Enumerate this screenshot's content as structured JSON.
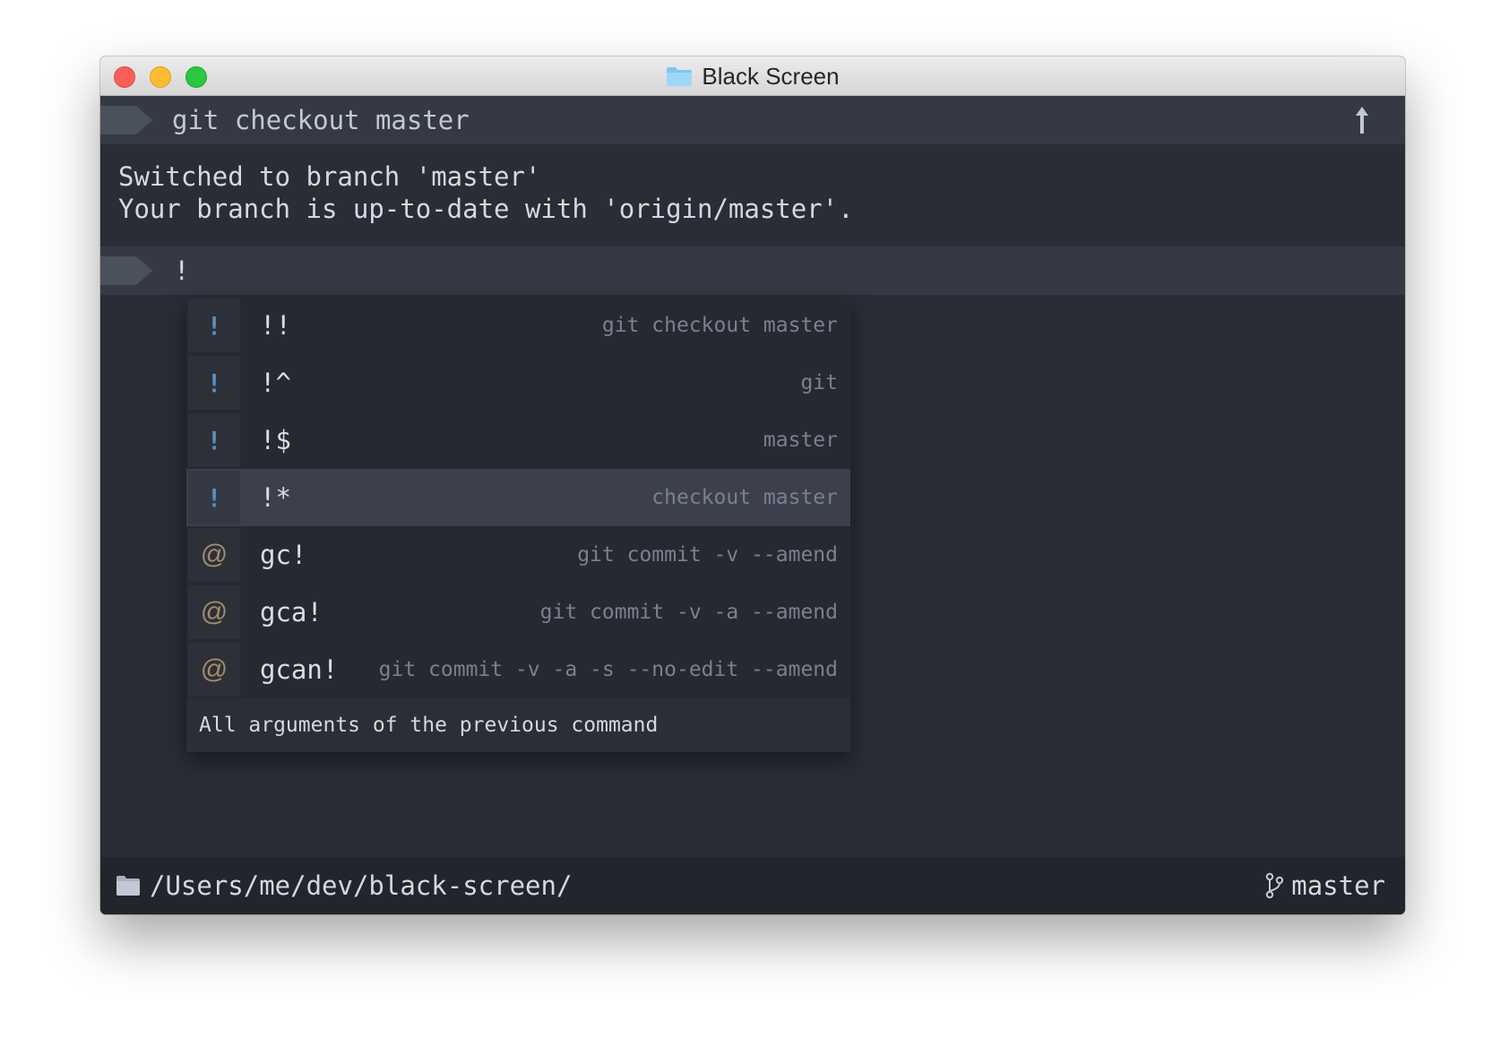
{
  "window": {
    "title": "Black Screen"
  },
  "previous_job": {
    "command": "git checkout master",
    "output_lines": [
      "Switched to branch 'master'",
      "Your branch is up-to-date with 'origin/master'."
    ]
  },
  "prompt": {
    "input": "!"
  },
  "autocomplete": {
    "items": [
      {
        "type": "history",
        "type_glyph": "!",
        "value": "!!",
        "description": "git checkout master",
        "selected": false
      },
      {
        "type": "history",
        "type_glyph": "!",
        "value": "!^",
        "description": "git",
        "selected": false
      },
      {
        "type": "history",
        "type_glyph": "!",
        "value": "!$",
        "description": "master",
        "selected": false
      },
      {
        "type": "history",
        "type_glyph": "!",
        "value": "!*",
        "description": "checkout master",
        "selected": true
      },
      {
        "type": "alias",
        "type_glyph": "@",
        "value": "gc!",
        "description": "git commit -v --amend",
        "selected": false
      },
      {
        "type": "alias",
        "type_glyph": "@",
        "value": "gca!",
        "description": "git commit -v -a --amend",
        "selected": false
      },
      {
        "type": "alias",
        "type_glyph": "@",
        "value": "gcan!",
        "description": "git commit -v -a -s --no-edit --amend",
        "selected": false
      }
    ],
    "footer": "All arguments of the previous command"
  },
  "status": {
    "cwd": "/Users/me/dev/black-screen/",
    "branch": "master"
  },
  "icons": {
    "title_folder": "folder-icon",
    "scroll_up": "arrow-up-icon",
    "cwd_folder": "folder-icon",
    "branch": "git-branch-icon"
  },
  "colors": {
    "background": "#2a2d36",
    "header": "#353944",
    "selected_row": "#3b404c",
    "history_glyph": "#5b8fbd",
    "alias_glyph": "#a58a6a"
  }
}
